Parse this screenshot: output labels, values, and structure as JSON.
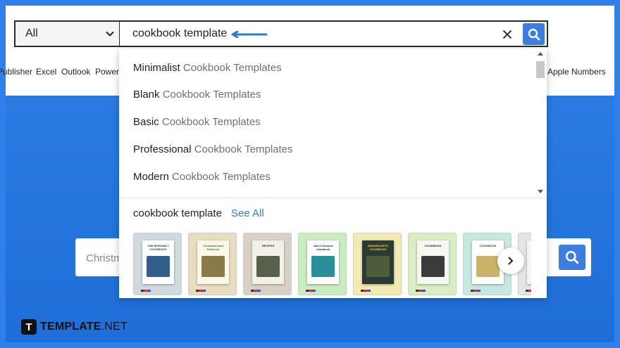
{
  "search": {
    "category": "All",
    "query": "cookbook template"
  },
  "app_nav": [
    "Publisher",
    "Excel",
    "Outlook",
    "Power",
    "Apple Numbers"
  ],
  "suggestions": [
    {
      "keyword": "Minimalist",
      "rest": " Cookbook Templates"
    },
    {
      "keyword": "Blank",
      "rest": " Cookbook Templates"
    },
    {
      "keyword": "Basic",
      "rest": " Cookbook Templates"
    },
    {
      "keyword": "Professional",
      "rest": " Cookbook Templates"
    },
    {
      "keyword": "Modern",
      "rest": " Cookbook Templates"
    }
  ],
  "results": {
    "query": "cookbook template",
    "see_all": "See All",
    "thumbnails": [
      {
        "title": "THE BIGFAMILY COOKBOOK",
        "bg": "#cfd9de",
        "cover": "#ffffff",
        "text_color": "#1d3a55",
        "img": "#2f5f8a"
      },
      {
        "title": "Consistent and Delicious",
        "bg": "#e8dcc1",
        "cover": "#fbf7e8",
        "text_color": "#2e7d32",
        "img": "#8a7a4a"
      },
      {
        "title": "RECIPES",
        "bg": "#d8d2c6",
        "cover": "#f3f0ea",
        "text_color": "#333333",
        "img": "#56604a"
      },
      {
        "title": "Jane's Dessert Cookbook",
        "bg": "#c9ecc0",
        "cover": "#ffffff",
        "text_color": "#1a2b2b",
        "img": "#2a8f9b"
      },
      {
        "title": "SEAGRA KETO COOKBOOK",
        "bg": "#f2eab2",
        "cover": "#2b3a34",
        "text_color": "#f7d847",
        "img": "#4d5d3c"
      },
      {
        "title": "COOKBOOK",
        "bg": "#d9efc3",
        "cover": "#f6f6f2",
        "text_color": "#222222",
        "img": "#3b3b3b"
      },
      {
        "title": "COOKBOOK",
        "bg": "#c7e7e1",
        "cover": "#ffffff",
        "text_color": "#333333",
        "img": "#c9b26a"
      },
      {
        "title": "",
        "bg": "#e5e5e5",
        "cover": "#f4f4f4",
        "text_color": "#333333",
        "img": "#bbbbbb"
      }
    ]
  },
  "hero": {
    "placeholder": "Christm"
  },
  "logo": {
    "mark": "T",
    "bold": "TEMPLATE",
    "rest": ".NET"
  },
  "colors": {
    "accent": "#3b7de0",
    "background": "#2f80ea",
    "link": "#2f7ad6"
  },
  "icons": [
    "chevron-down-icon",
    "close-icon",
    "search-icon",
    "arrow-left-icon",
    "chevron-right-icon"
  ]
}
